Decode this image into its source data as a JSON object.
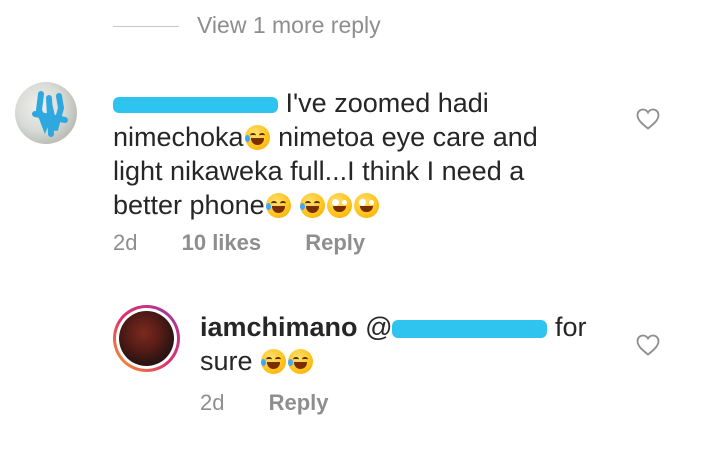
{
  "view_more": {
    "label": "View 1 more reply"
  },
  "comment1": {
    "text_line1": "I've zoomed hadi",
    "text_line2a": "nimechoka",
    "text_line2b": " nimetoa eye care and",
    "text_line3": "light nikaweka full...I think I need a",
    "text_line4": "better phone",
    "time": "2d",
    "likes": "10 likes",
    "reply": "Reply"
  },
  "comment2": {
    "username": "iamchimano",
    "at": "@",
    "text_after": " for",
    "text_line2": "sure",
    "time": "2d",
    "reply": "Reply"
  },
  "icons": {
    "heart": "heart-outline-icon",
    "laughing": "rolling-on-floor-laughing-emoji",
    "zany": "zany-face-emoji"
  },
  "colors": {
    "text": "#262626",
    "secondary": "#8e8e8e",
    "redaction": "#2fc3f0",
    "story_ring": "#e1306c"
  }
}
